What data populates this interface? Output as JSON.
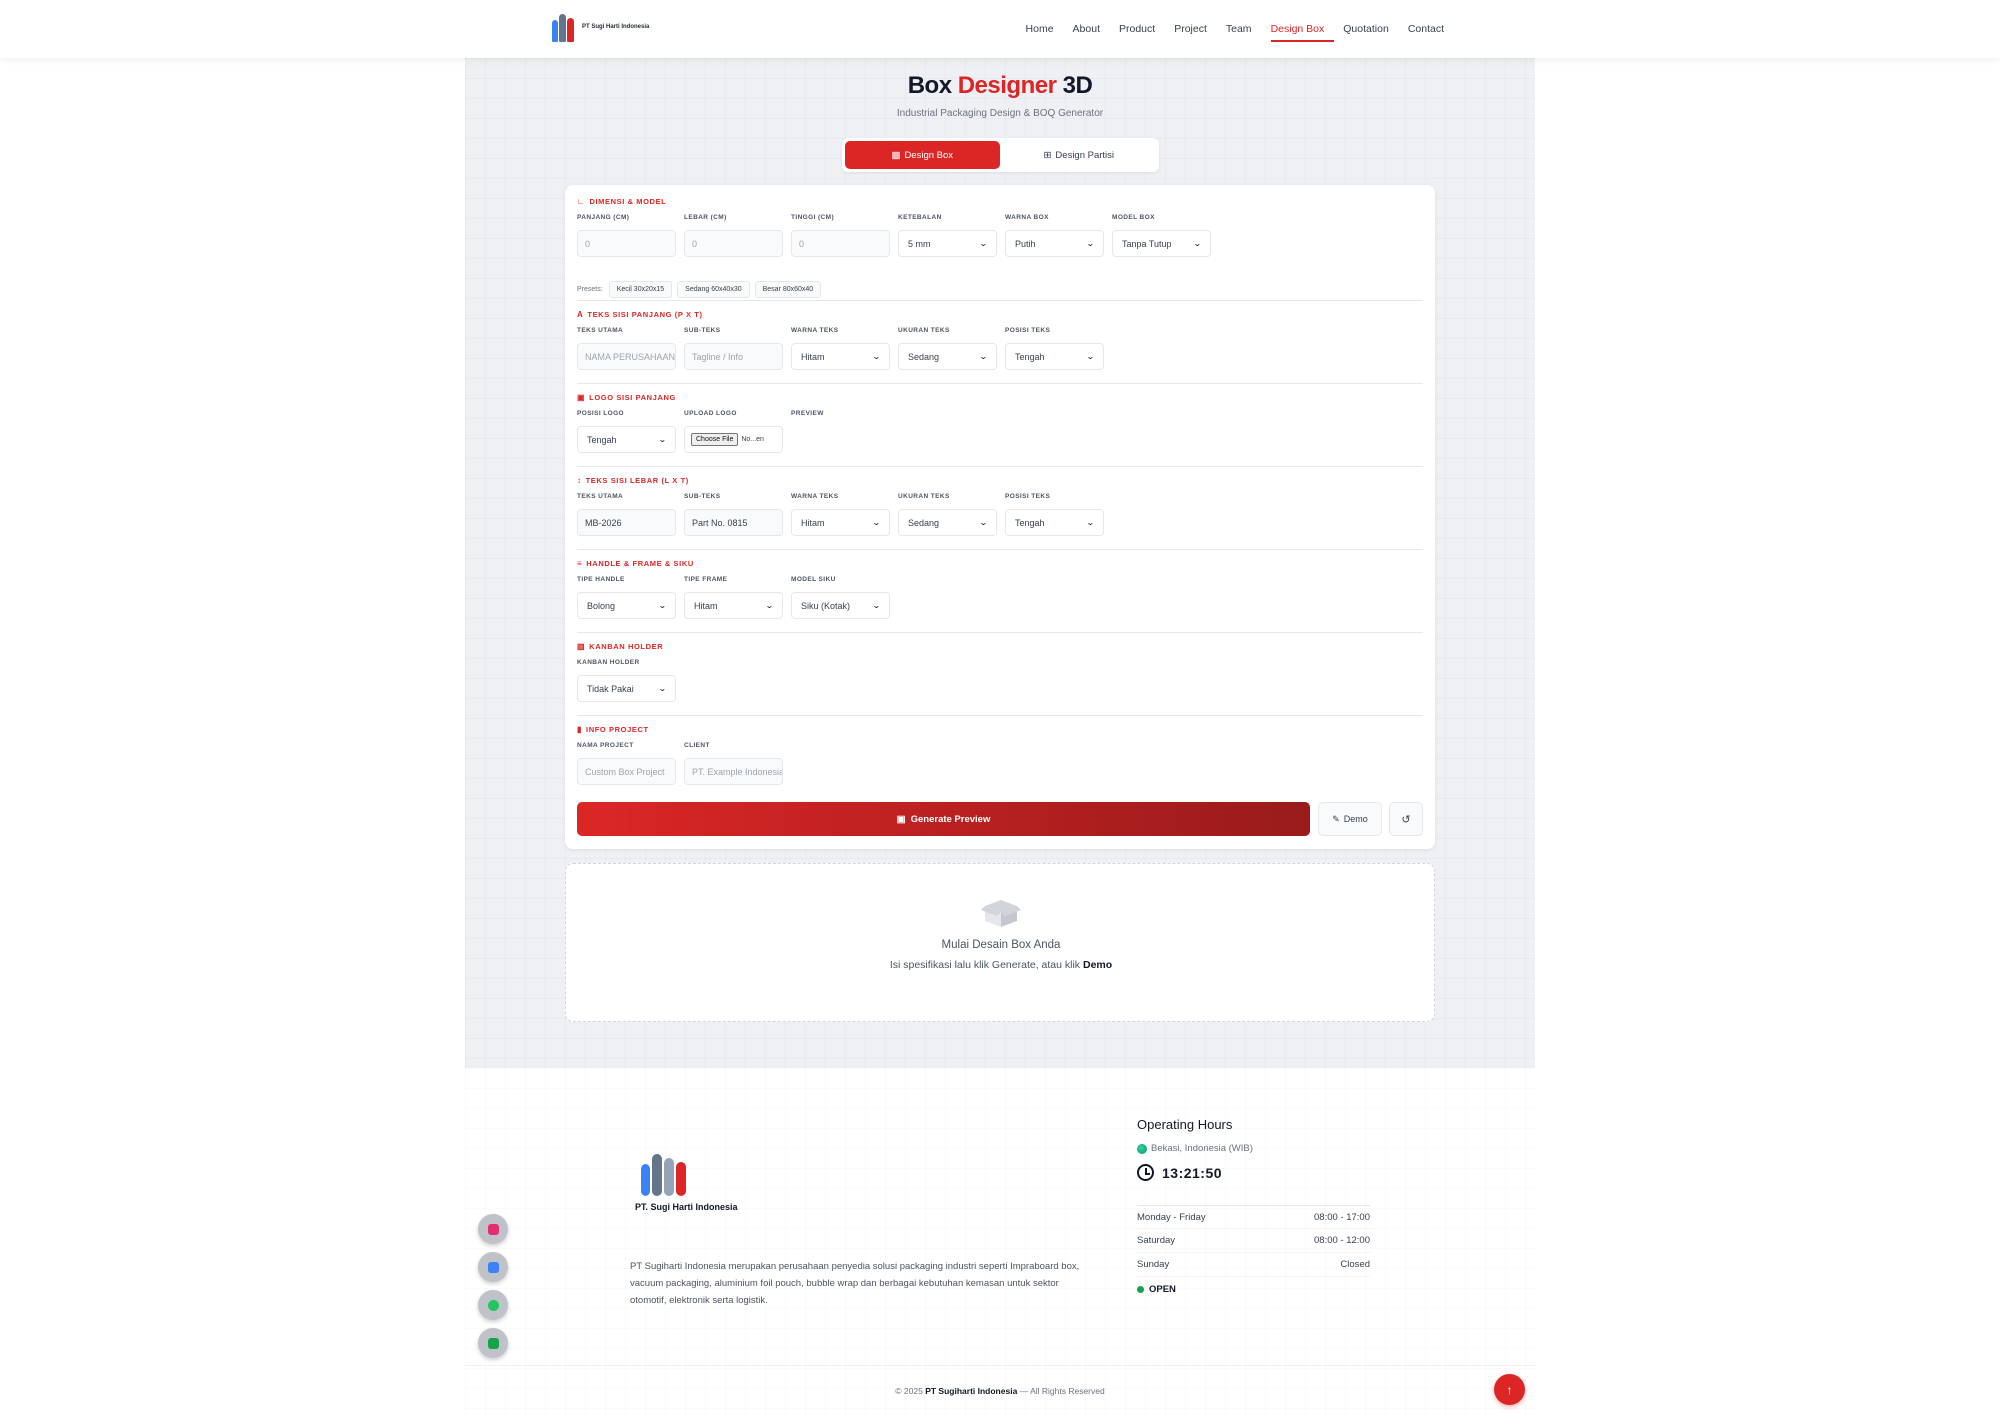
{
  "brand": {
    "nav_name": "PT Sugi Harti Indonesia",
    "footer_name": "PT. Sugi Harti Indonesia",
    "logo_colors": [
      "#3b82f6",
      "#dc2626",
      "#64748b"
    ]
  },
  "nav": {
    "links": [
      "Home",
      "About",
      "Product",
      "Project",
      "Team",
      "Design Box",
      "Quotation",
      "Contact"
    ],
    "active": "Design Box"
  },
  "header": {
    "title_part1": "Box",
    "title_accent": "Designer",
    "title_part2": "3D",
    "subtitle": "Industrial Packaging Design & BOQ Generator"
  },
  "tabs": [
    {
      "label": "Design Box",
      "icon": "box-icon",
      "active": true
    },
    {
      "label": "Design Partisi",
      "icon": "grid-icon",
      "active": false
    }
  ],
  "sections": {
    "dimensi": {
      "title": "Dimensi & Model",
      "fields": [
        {
          "label": "Panjang (cm)",
          "type": "input",
          "value": "",
          "placeholder": "0"
        },
        {
          "label": "Lebar (cm)",
          "type": "input",
          "value": "",
          "placeholder": "0"
        },
        {
          "label": "Tinggi (cm)",
          "type": "input",
          "value": "",
          "placeholder": "0"
        },
        {
          "label": "Ketebalan",
          "type": "select",
          "value": "5 mm"
        },
        {
          "label": "Warna Box",
          "type": "select",
          "value": "Putih"
        },
        {
          "label": "Model Box",
          "type": "select",
          "value": "Tanpa Tutup"
        }
      ],
      "presets_label": "Presets:",
      "presets": [
        "Kecil 30x20x15",
        "Sedang 60x40x30",
        "Besar 80x60x40"
      ]
    },
    "teks_panjang": {
      "title": "Teks Sisi Panjang (P x T)",
      "fields": [
        {
          "label": "Teks Utama",
          "type": "input",
          "value": "",
          "placeholder": "NAMA PERUSAHAAN"
        },
        {
          "label": "Sub-Teks",
          "type": "input",
          "value": "",
          "placeholder": "Tagline / Info"
        },
        {
          "label": "Warna Teks",
          "type": "select",
          "value": "Hitam"
        },
        {
          "label": "Ukuran Teks",
          "type": "select",
          "value": "Sedang"
        },
        {
          "label": "Posisi Teks",
          "type": "select",
          "value": "Tengah"
        }
      ]
    },
    "logo_panjang": {
      "title": "Logo Sisi Panjang",
      "fields": [
        {
          "label": "Posisi Logo",
          "type": "select",
          "value": "Tengah"
        },
        {
          "label": "Upload Logo",
          "type": "file",
          "button": "Choose File",
          "value": "No...en"
        },
        {
          "label": "Preview",
          "type": "none"
        }
      ]
    },
    "teks_lebar": {
      "title": "Teks Sisi Lebar (L x T)",
      "fields": [
        {
          "label": "Teks Utama",
          "type": "input",
          "value": "MB-2026",
          "placeholder": ""
        },
        {
          "label": "Sub-Teks",
          "type": "input",
          "value": "Part No. 0815",
          "placeholder": ""
        },
        {
          "label": "Warna Teks",
          "type": "select",
          "value": "Hitam"
        },
        {
          "label": "Ukuran Teks",
          "type": "select",
          "value": "Sedang"
        },
        {
          "label": "Posisi Teks",
          "type": "select",
          "value": "Tengah"
        }
      ]
    },
    "handle": {
      "title": "Handle & Frame & Siku",
      "fields": [
        {
          "label": "Tipe Handle",
          "type": "select",
          "value": "Bolong"
        },
        {
          "label": "Tipe Frame",
          "type": "select",
          "value": "Hitam"
        },
        {
          "label": "Model Siku",
          "type": "select",
          "value": "Siku (Kotak)"
        }
      ]
    },
    "kanban": {
      "title": "Kanban Holder",
      "fields": [
        {
          "label": "Kanban Holder",
          "type": "select",
          "value": "Tidak Pakai"
        }
      ]
    },
    "info": {
      "title": "Info Project",
      "fields": [
        {
          "label": "Nama Project",
          "type": "input",
          "value": "",
          "placeholder": "Custom Box Project"
        },
        {
          "label": "Client",
          "type": "input",
          "value": "",
          "placeholder": "PT. Example Indonesia"
        }
      ]
    }
  },
  "actions": {
    "generate": "Generate Preview",
    "demo": "Demo"
  },
  "preview": {
    "title": "Mulai Desain Box Anda",
    "sub_before": "Isi spesifikasi lalu klik Generate, atau klik",
    "sub_bold": "Demo"
  },
  "footer": {
    "description": "PT Sugiharti Indonesia merupakan perusahaan penyedia solusi packaging industri seperti Impraboard box, vacuum packaging, aluminium foil pouch, bubble wrap dan berbagai kebutuhan kemasan untuk sektor otomotif, elektronik serta logistik.",
    "social": [
      {
        "icon": "instagram-icon",
        "color": "#e1306c"
      },
      {
        "icon": "linkedin-icon",
        "color": "#3b82f6"
      },
      {
        "icon": "whatsapp-icon",
        "color": "#22c55e"
      },
      {
        "icon": "tokopedia-icon",
        "color": "#16a34a"
      }
    ],
    "hours": {
      "title": "Operating Hours",
      "location": "Bekasi, Indonesia (WIB)",
      "time": "13:21:50",
      "rows": [
        {
          "day": "Monday - Friday",
          "time": "08:00 - 17:00"
        },
        {
          "day": "Saturday",
          "time": "08:00 - 12:00"
        },
        {
          "day": "Sunday",
          "time": "Closed"
        }
      ],
      "status": "OPEN"
    },
    "copyright_prefix": "© 2025",
    "copyright_company": "PT Sugiharti Indonesia",
    "copyright_suffix": "— All Rights Reserved"
  },
  "colors": {
    "accent": "#dc2626",
    "accent_dark": "#991b1b",
    "open_status": "#16a34a"
  }
}
